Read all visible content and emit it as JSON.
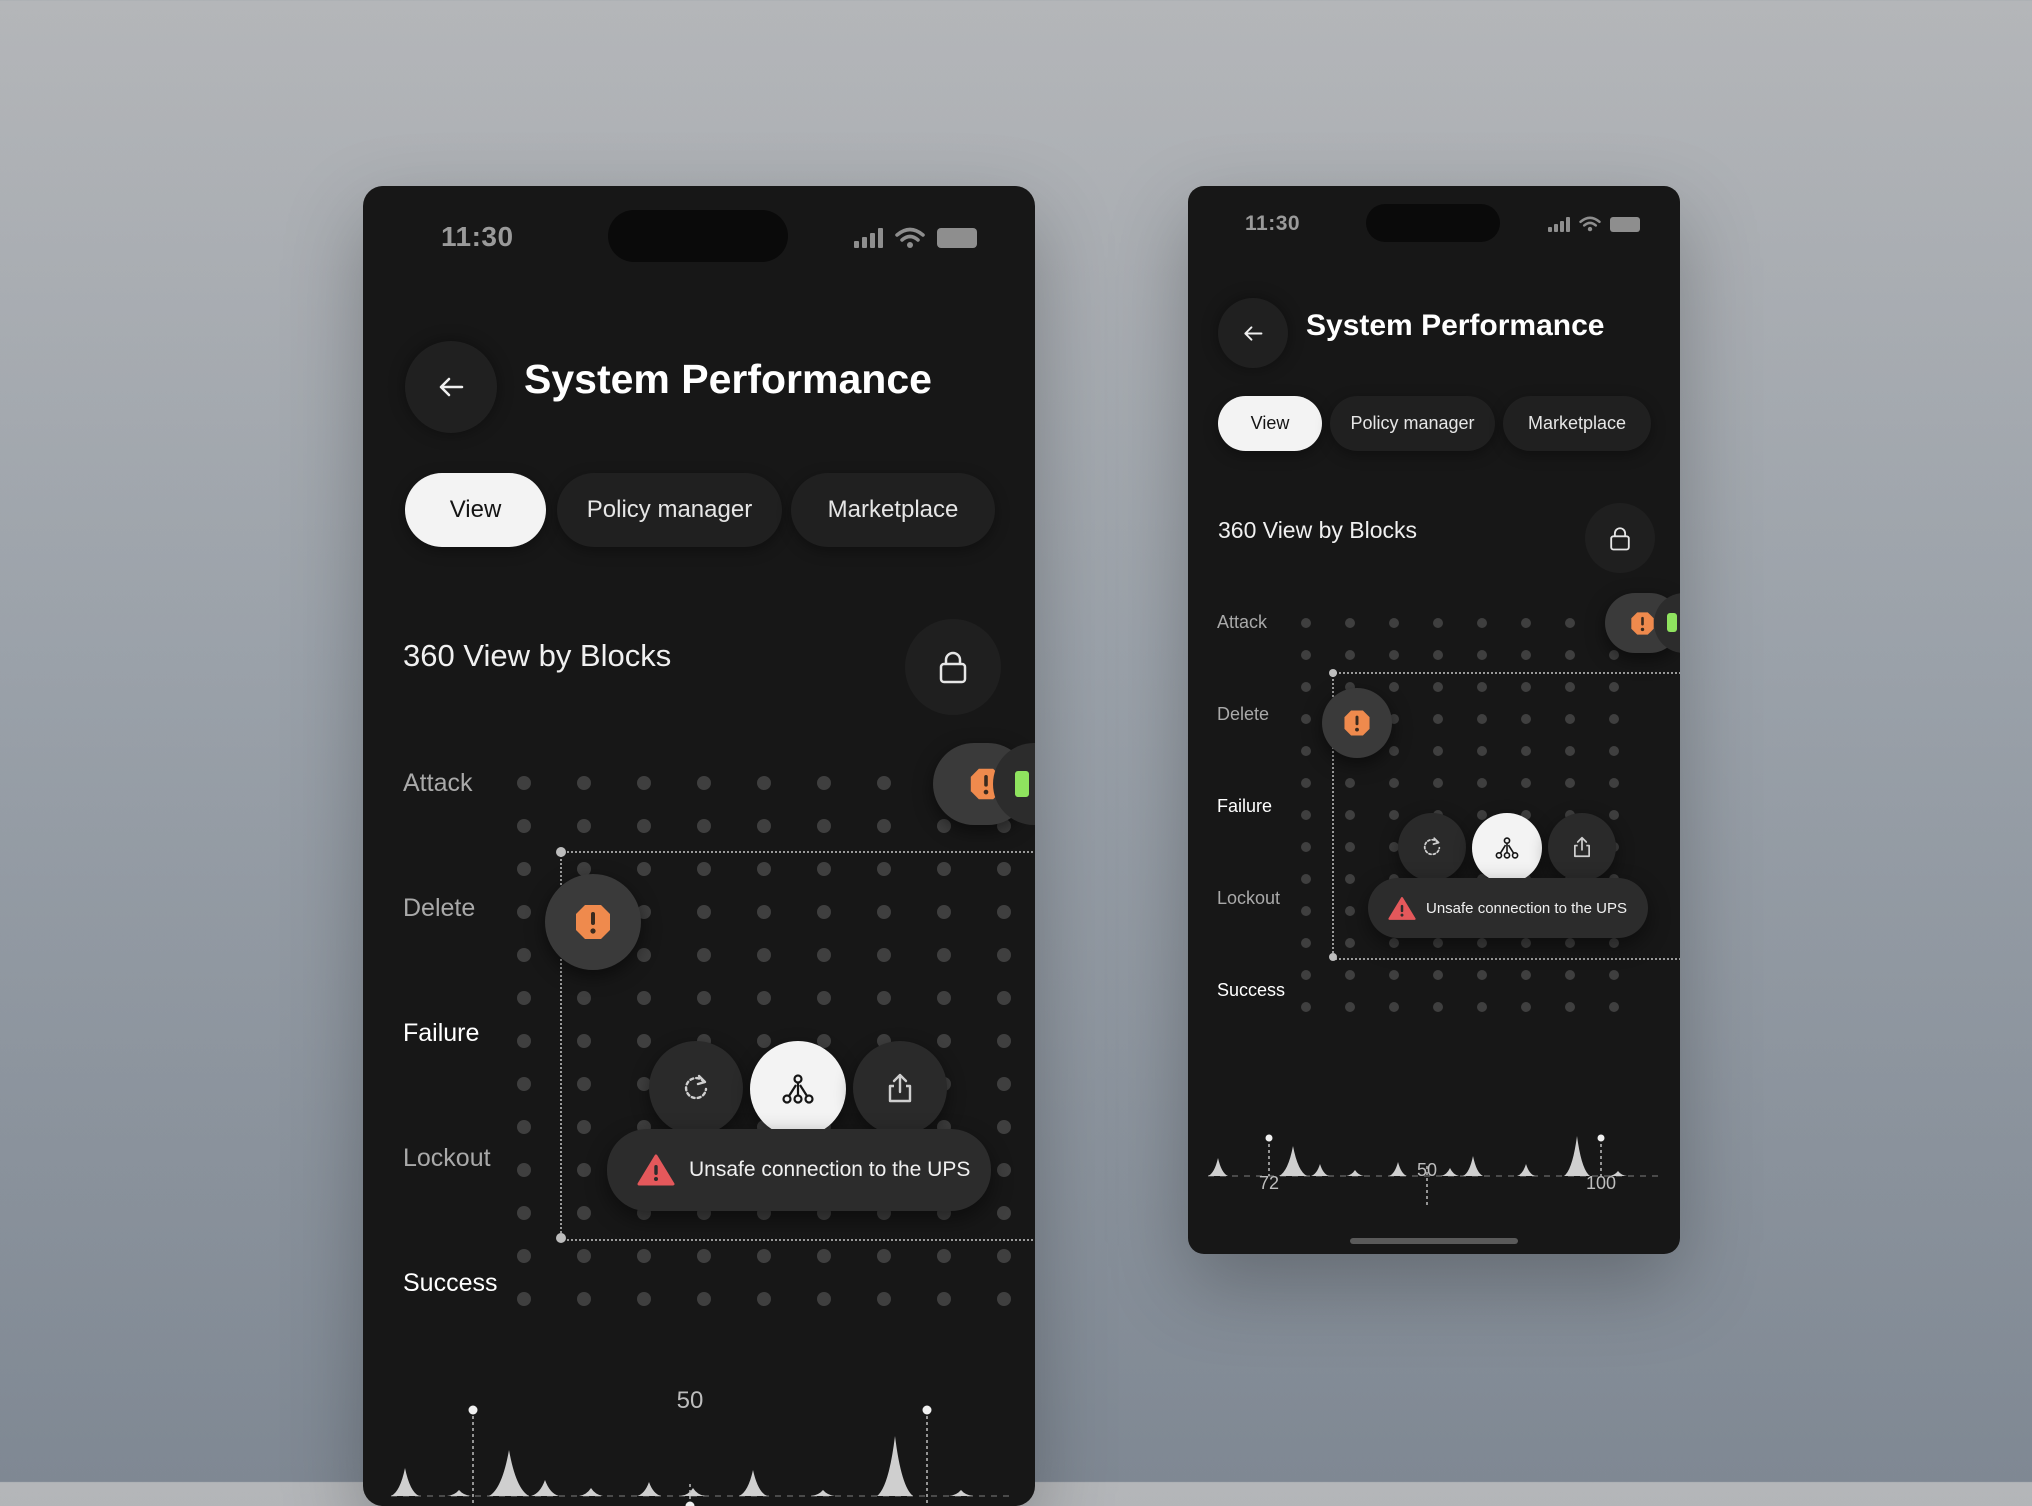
{
  "status_bar": {
    "time": "11:30"
  },
  "header": {
    "back_label": "Back",
    "title": "System Performance"
  },
  "tabs": [
    {
      "label": "View",
      "active": true
    },
    {
      "label": "Policy manager",
      "active": false
    },
    {
      "label": "Marketplace",
      "active": false
    }
  ],
  "section": {
    "title": "360 View by Blocks"
  },
  "rows": [
    "Attack",
    "Delete",
    "Failure",
    "Lockout",
    "Success"
  ],
  "highlighted_row": "Failure",
  "actions": [
    {
      "name": "refresh",
      "icon": "refresh-icon"
    },
    {
      "name": "network",
      "icon": "network-icon",
      "active": true
    },
    {
      "name": "share",
      "icon": "share-icon"
    }
  ],
  "alert": {
    "text": "Unsafe connection to the UPS",
    "icon": "warning-icon"
  },
  "chart_data": {
    "type": "area",
    "markers": [
      {
        "label": "72"
      },
      {
        "label": "50"
      },
      {
        "label": "100"
      }
    ]
  },
  "colors": {
    "background": "#171717",
    "accent_orange": "#ef8a4d",
    "accent_green": "#8fe35f",
    "alert_red": "#e4585b",
    "active_tab": "#f3f3f3"
  }
}
